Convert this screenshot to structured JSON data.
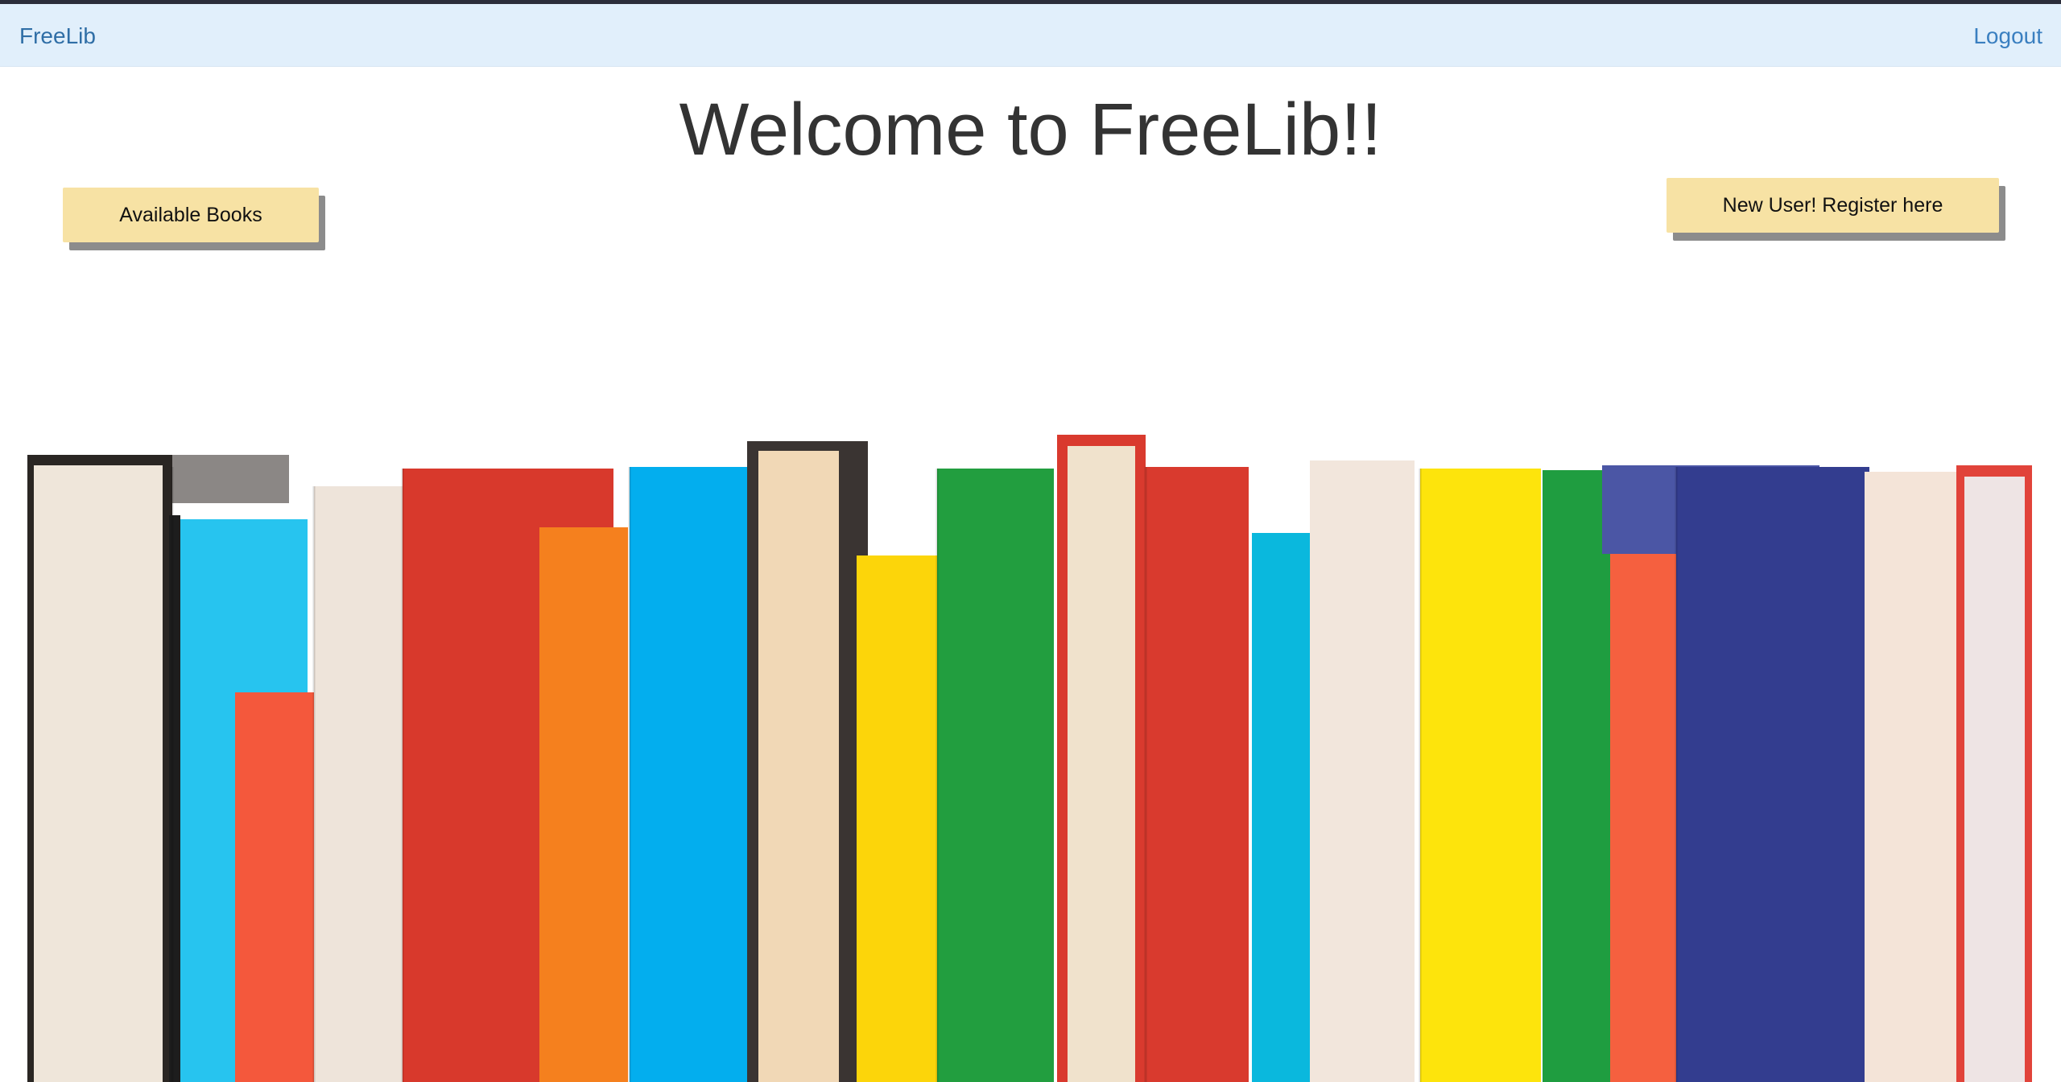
{
  "navbar": {
    "brand": "FreeLib",
    "logout": "Logout"
  },
  "main": {
    "title": "Welcome to FreeLib!!",
    "available_books_label": "Available Books",
    "register_label": "New User! Register here"
  },
  "image": {
    "description_name": "colorful-books-row",
    "books": [
      {
        "color": "#efe6da"
      },
      {
        "color": "#27c4ef"
      },
      {
        "color": "#f4583c"
      },
      {
        "color": "#eee4da"
      },
      {
        "color": "#d8392c"
      },
      {
        "color": "#f5801e"
      },
      {
        "color": "#03aeee"
      },
      {
        "color": "#f1d8b6"
      },
      {
        "color": "#fcd50a"
      },
      {
        "color": "#229e3f"
      },
      {
        "color": "#f0e2cc"
      },
      {
        "color": "#d93a2e"
      },
      {
        "color": "#0ab8dd"
      },
      {
        "color": "#f2e6dc"
      },
      {
        "color": "#fde40c"
      },
      {
        "color": "#1f9d40"
      },
      {
        "color": "#f5603f"
      },
      {
        "color": "#333d8f"
      },
      {
        "color": "#f4e4d8"
      },
      {
        "color": "#eee4e4"
      }
    ]
  }
}
